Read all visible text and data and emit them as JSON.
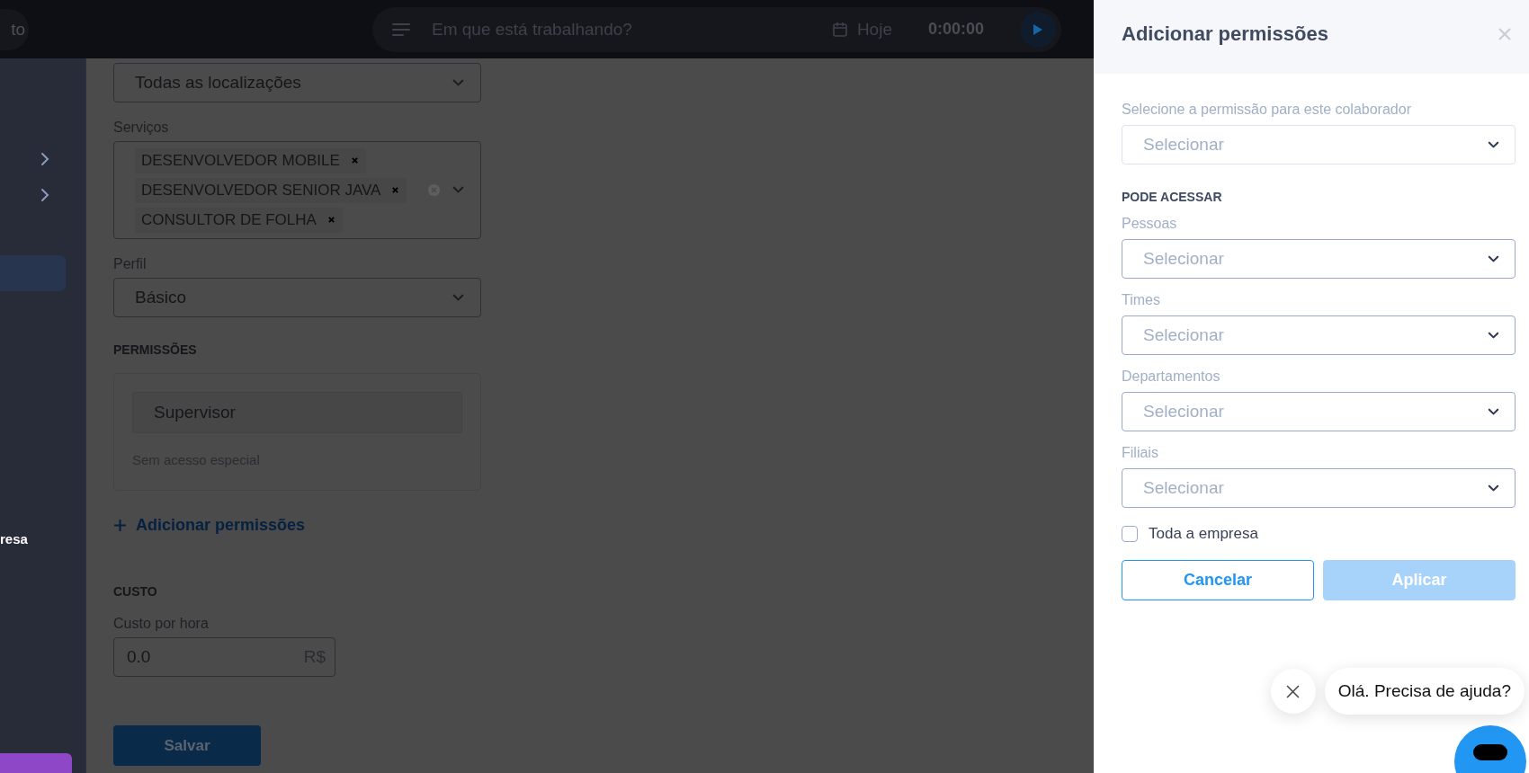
{
  "topbar": {
    "left_pill_text": "to",
    "search": {
      "placeholder": "Em que está trabalhando?"
    },
    "date_label": "Hoje",
    "timer": "0:00:00"
  },
  "sidebar": {
    "items": [
      {
        "kind": "chevron",
        "selected": false
      },
      {
        "kind": "chevron",
        "selected": false
      },
      {
        "kind": "blank",
        "selected": true
      },
      {
        "kind": "text",
        "label": "resa",
        "selected": false
      }
    ]
  },
  "form": {
    "location_select": {
      "value": "Todas as localizações"
    },
    "services": {
      "label": "Serviços",
      "tags": [
        "DESENVOLVEDOR MOBILE",
        "DESENVOLVEDOR SENIOR JAVA",
        "CONSULTOR DE FOLHA"
      ]
    },
    "profile": {
      "label": "Perfil",
      "value": "Básico"
    },
    "permissions": {
      "heading": "PERMISSÕES",
      "items": [
        {
          "role": "Supervisor",
          "description": "Sem acesso especial"
        }
      ],
      "add_link": "Adicionar permissões"
    },
    "cost": {
      "heading": "CUSTO",
      "label": "Custo por hora",
      "value": "0.0",
      "unit": "R$"
    },
    "save_button": "Salvar"
  },
  "drawer": {
    "title": "Adicionar permissões",
    "permission_select": {
      "label": "Selecione a permissão para este colaborador",
      "placeholder": "Selecionar"
    },
    "access": {
      "heading": "PODE ACESSAR",
      "fields": [
        {
          "label": "Pessoas",
          "placeholder": "Selecionar"
        },
        {
          "label": "Times",
          "placeholder": "Selecionar"
        },
        {
          "label": "Departamentos",
          "placeholder": "Selecionar"
        },
        {
          "label": "Filiais",
          "placeholder": "Selecionar"
        }
      ]
    },
    "whole_company": {
      "label": "Toda a empresa",
      "checked": false
    },
    "buttons": [
      {
        "label": "Cancelar",
        "kind": "secondary",
        "disabled": false
      },
      {
        "label": "Aplicar",
        "kind": "primary",
        "disabled": true
      }
    ]
  },
  "chat": {
    "message": "Olá. Precisa de ajuda?"
  }
}
